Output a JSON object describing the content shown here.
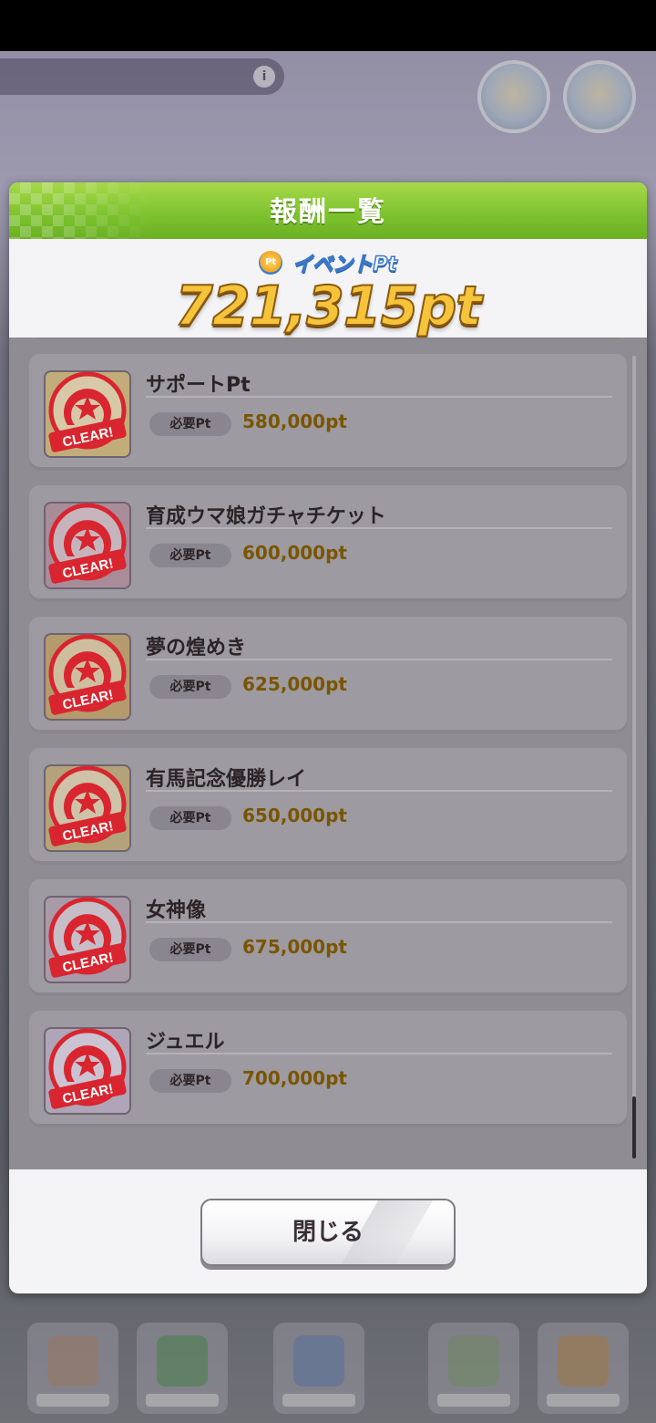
{
  "dialog": {
    "title": "報酬一覧",
    "points_label": "イベントPt",
    "points_value": "721,315pt",
    "close_label": "閉じる"
  },
  "stamp_text": "CLEAR!",
  "rewards": [
    {
      "name": "",
      "req_label": "必要Pt",
      "req_value": ""
    },
    {
      "name": "サポートPt",
      "req_label": "必要Pt",
      "req_value": "580,000pt"
    },
    {
      "name": "育成ウマ娘ガチャチケット",
      "req_label": "必要Pt",
      "req_value": "600,000pt"
    },
    {
      "name": "夢の煌めき",
      "req_label": "必要Pt",
      "req_value": "625,000pt"
    },
    {
      "name": "有馬記念優勝レイ",
      "req_label": "必要Pt",
      "req_value": "650,000pt"
    },
    {
      "name": "女神像",
      "req_label": "必要Pt",
      "req_value": "675,000pt"
    },
    {
      "name": "ジュエル",
      "req_label": "必要Pt",
      "req_value": "700,000pt"
    }
  ],
  "colors": {
    "header_green": "#7cc12d",
    "points_gold": "#f6c43a",
    "stamp_red": "#d9252f",
    "req_value": "#7a5500"
  }
}
